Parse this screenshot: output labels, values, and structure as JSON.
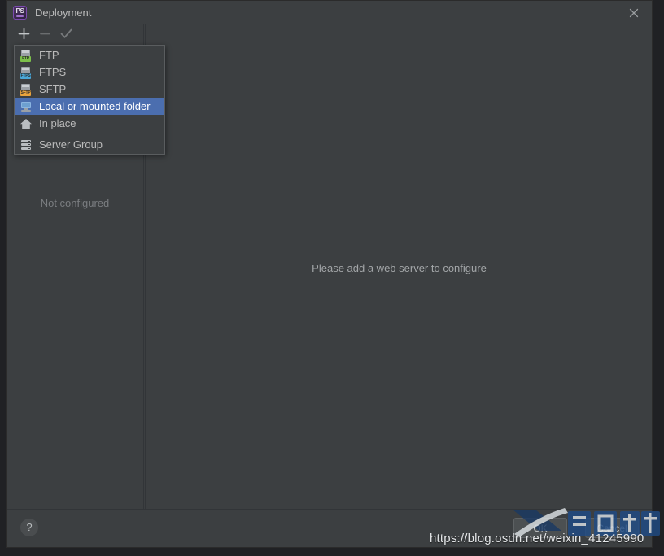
{
  "window": {
    "title": "Deployment",
    "app_icon": "phpstorm-ps-icon",
    "close_icon": "close-icon"
  },
  "toolbar": {
    "add_label": "+",
    "add_icon": "plus-icon",
    "remove_label": "−",
    "remove_icon": "minus-icon",
    "check_icon": "checkmark-icon"
  },
  "left_panel": {
    "empty_state": "Not configured"
  },
  "right_panel": {
    "empty_state": "Please add a web server to configure"
  },
  "popup_menu": {
    "items": [
      {
        "label": "FTP",
        "icon": "ftp-icon",
        "badge": "FTP",
        "selected": false
      },
      {
        "label": "FTPS",
        "icon": "ftps-icon",
        "badge": "FTPS",
        "selected": false
      },
      {
        "label": "SFTP",
        "icon": "sftp-icon",
        "badge": "SFTP",
        "selected": false
      },
      {
        "label": "Local or mounted folder",
        "icon": "local-folder-icon",
        "badge": "",
        "selected": true
      },
      {
        "label": "In place",
        "icon": "home-icon",
        "badge": "",
        "selected": false
      },
      {
        "label": "Server Group",
        "icon": "server-group-icon",
        "badge": "",
        "selected": false
      }
    ],
    "separator_before_index": 5,
    "highlight_color": "#4b6eaf"
  },
  "bottom_bar": {
    "help_label": "?",
    "help_icon": "help-icon",
    "ok_label": "OK",
    "cancel_label": "Cancel"
  },
  "watermark": {
    "url": "https://blog.osdn.net/weixin_41245990",
    "logo_text": "自由互联"
  },
  "colors": {
    "dialog_bg": "#3c3f41",
    "text": "#bbbbbb",
    "muted_text": "#7a7d80",
    "selection": "#4b6eaf",
    "border": "#2b2b2b"
  }
}
